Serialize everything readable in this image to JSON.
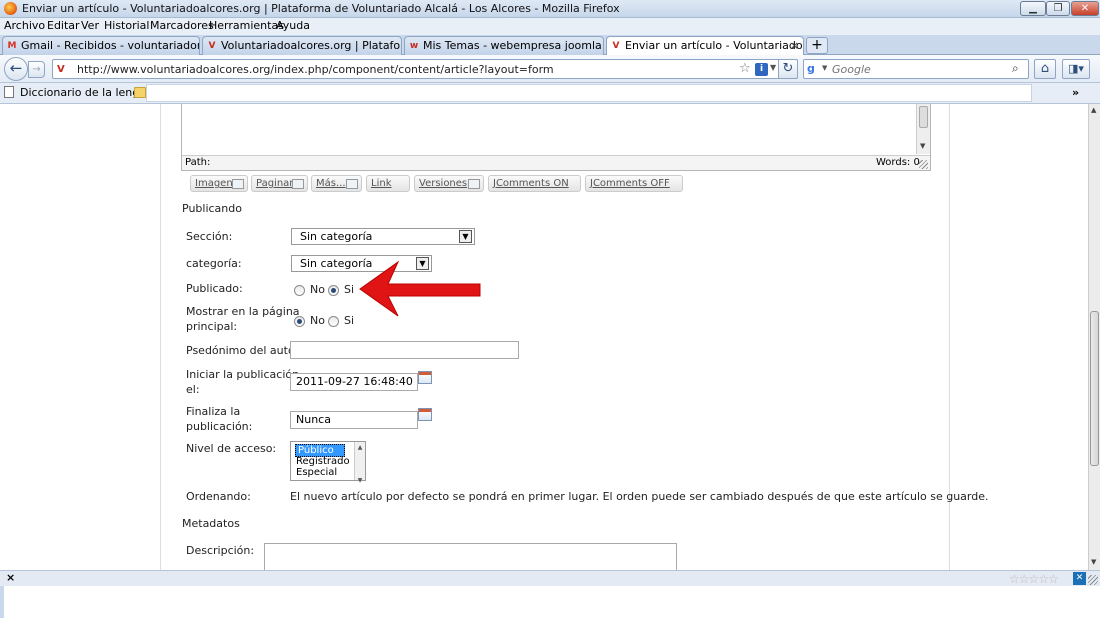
{
  "window": {
    "title": "Enviar un artículo - Voluntariadoalcores.org | Plataforma de Voluntariado Alcalá - Los Alcores - Mozilla Firefox",
    "min_label": "▁",
    "max_label": "❐",
    "close_label": "✕"
  },
  "menu": [
    "Archivo",
    "Editar",
    "Ver",
    "Historial",
    "Marcadores",
    "Herramientas",
    "Ayuda"
  ],
  "tabs": [
    {
      "label": "Gmail - Recibidos - voluntariadomair...",
      "favicon": "M",
      "favicon_color": "#d93025",
      "active": false
    },
    {
      "label": "Voluntariadoalcores.org | Plataforma ...",
      "favicon": "V",
      "favicon_color": "#c62a1a",
      "active": false
    },
    {
      "label": "Mis Temas - webempresa joomla - H...",
      "favicon": "w",
      "favicon_color": "#c62a1a",
      "active": false
    },
    {
      "label": "Enviar un artículo - Voluntariadoalcor...",
      "favicon": "V",
      "favicon_color": "#c62a1a",
      "active": true
    }
  ],
  "tab_close": "×",
  "new_tab": "+",
  "nav": {
    "url": "http://www.voluntariadoalcores.org/index.php/component/content/article?layout=form",
    "search_placeholder": "Google",
    "back": "←",
    "forward": "→",
    "reload": "↻",
    "home": "⌂",
    "addon": "◨▾",
    "star": "☆",
    "info": "i",
    "search_icon": "⌕",
    "google_icon": "g"
  },
  "bookmarks": {
    "item": "Diccionario de la leng...",
    "chevron": "»"
  },
  "editor": {
    "path": "Path:",
    "words": "Words: 0"
  },
  "editor_buttons": [
    "Imagen",
    "Paginar",
    "Más...",
    "Link",
    "Versiones",
    "JComments ON",
    "JComments OFF"
  ],
  "form": {
    "publishing_title": "Publicando",
    "section_label": "Sección:",
    "section_value": "Sin categoría",
    "category_label": "categoría:",
    "category_value": "Sin categoría",
    "published_label": "Publicado:",
    "published_no": "No",
    "published_si": "Si",
    "frontpage_label_1": "Mostrar en la página",
    "frontpage_label_2": "principal:",
    "frontpage_no": "No",
    "frontpage_si": "Si",
    "alias_label": "Psedónimo del autor:",
    "alias_value": "",
    "publish_up_label_1": "Iniciar la publicación",
    "publish_up_label_2": "el:",
    "publish_up_value": "2011-09-27 16:48:40",
    "publish_down_label_1": "Finaliza la",
    "publish_down_label_2": "publicación:",
    "publish_down_value": "Nunca",
    "access_label": "Nivel de acceso:",
    "access_options": [
      "Público",
      "Registrado",
      "Especial"
    ],
    "access_selected": "Público",
    "ordering_label": "Ordenando:",
    "ordering_text": "El nuevo artículo por defecto se pondrá en primer lugar. El orden puede ser cambiado después de que este artículo se guarde.",
    "metadata_title": "Metadatos",
    "description_label": "Descripción:"
  },
  "statusbar": {
    "close": "×",
    "stars": "☆☆☆☆☆",
    "xmarks": "✕"
  },
  "colors": {
    "arrow": "#e01414",
    "selection": "#3399ff"
  }
}
